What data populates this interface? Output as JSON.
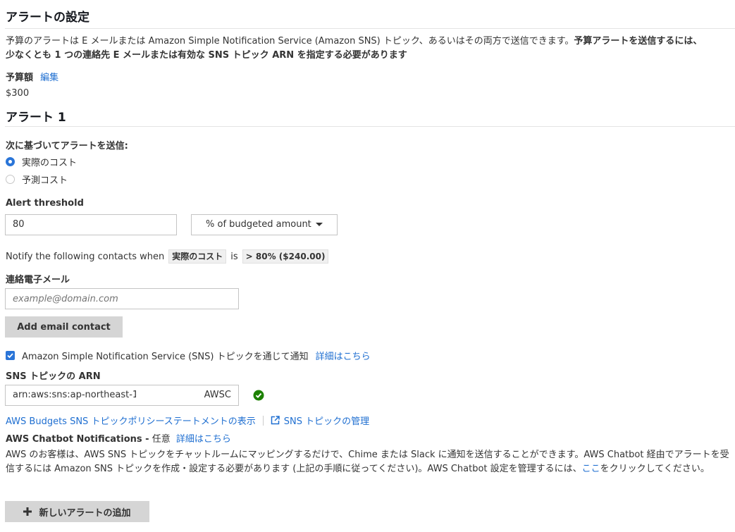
{
  "section": {
    "title": "アラートの設定",
    "intro_normal": "予算のアラートは E メールまたは Amazon Simple Notification Service (Amazon SNS) トピック、あるいはその両方で送信できます。",
    "intro_bold_1": "予算アラートを送信するには、",
    "intro_bold_2": "少なくとも 1 つの連絡先 E メールまたは有効な SNS トピック ARN を指定する必要があります",
    "budget_label": "予算額",
    "edit_link": "編集",
    "budget_amount": "$300"
  },
  "alert": {
    "title": "アラート 1",
    "send_based_on_label": "次に基づいてアラートを送信:",
    "options": {
      "actual": "実際のコスト",
      "forecast": "予測コスト"
    },
    "threshold_label": "Alert threshold",
    "threshold_value": "80",
    "threshold_unit": "% of budgeted amount",
    "notify_prefix": "Notify the following contacts when",
    "notify_metric": "実際のコスト",
    "notify_is": "is",
    "notify_condition": "> 80% ($240.00)",
    "email_label": "連絡電子メール",
    "email_placeholder": "example@domain.com",
    "add_email_button": "Add email contact",
    "sns_checkbox_label": "Amazon Simple Notification Service (SNS) トピックを通じて通知",
    "sns_learn_more": "詳細はこちら",
    "sns_arn_label": "SNS トピックの ARN",
    "sns_arn_value_left": "arn:aws:sns:ap-northeast-1:",
    "sns_arn_value_right": "AWSC",
    "policy_link": "AWS Budgets SNS トピックポリシーステートメントの表示",
    "manage_sns_link": "SNS トピックの管理",
    "chatbot_title": "AWS Chatbot Notifications -",
    "chatbot_optional": "任意",
    "chatbot_learn_more": "詳細はこちら",
    "chatbot_desc_1": "AWS のお客様は、AWS SNS トピックをチャットルームにマッピングするだけで、Chime または Slack に通知を送信することができます。AWS Chatbot 経由でアラートを受信するには Amazon SNS トピックを作成・設定する必要があります (上記の手順に従ってください)。AWS Chatbot 設定を管理するには、",
    "chatbot_here_link": "ここ",
    "chatbot_desc_2": "をクリックしてください。"
  },
  "add_alert_button": "新しいアラートの追加",
  "colors": {
    "link": "#1f6fd1",
    "radio_selected": "#2a75d8",
    "checkbox": "#2a75d8",
    "success": "#1d8102",
    "button_gray": "#d5d5d5"
  }
}
